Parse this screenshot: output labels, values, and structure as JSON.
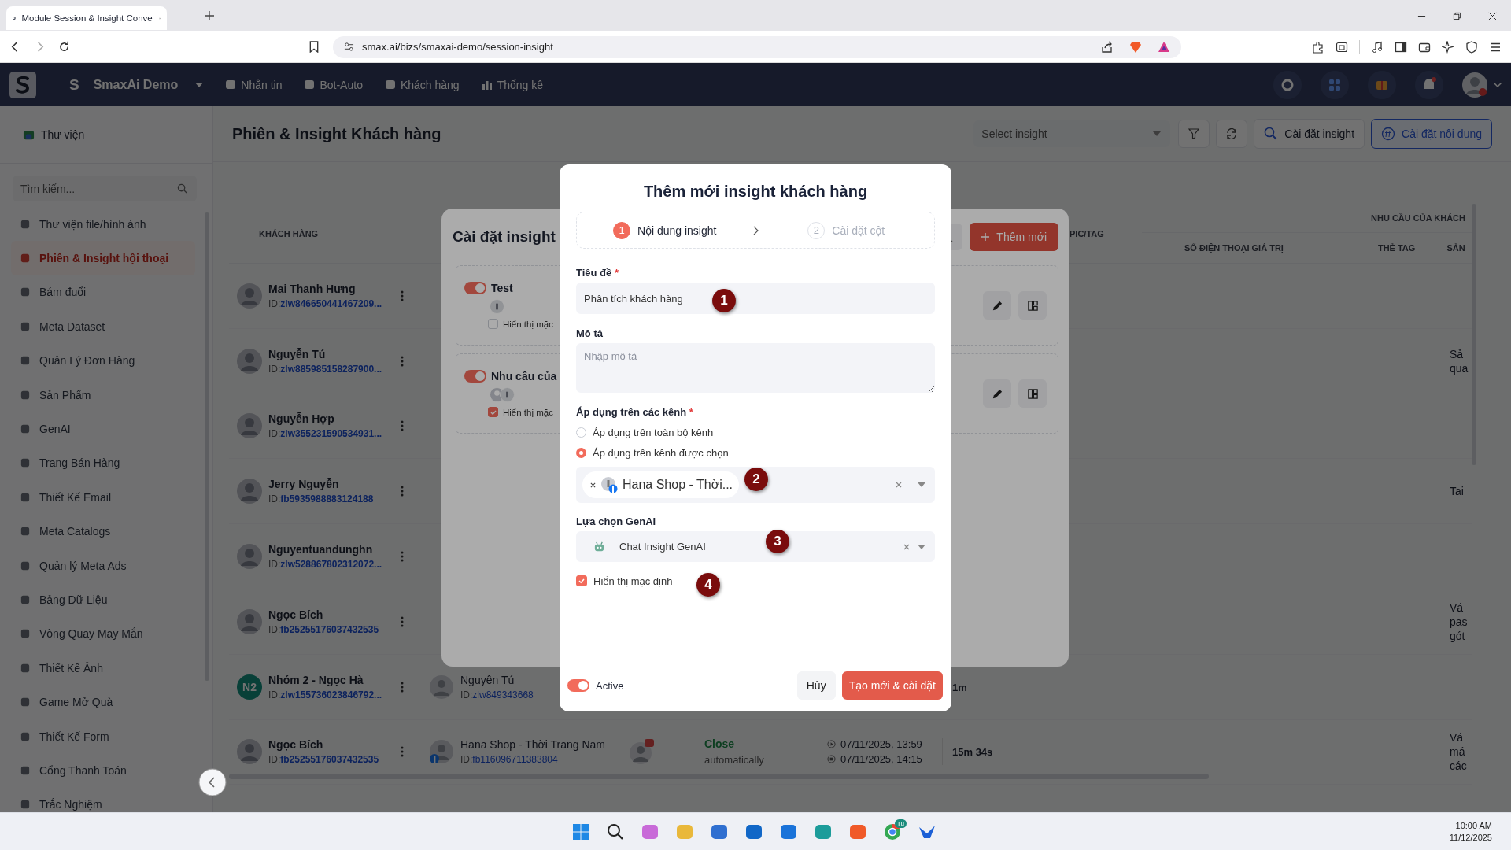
{
  "browser": {
    "tab_title": "Module Session & Insight Conve",
    "url": "smax.ai/bizs/smaxai-demo/session-insight"
  },
  "navbar": {
    "workspace_letter": "S",
    "workspace": "SmaxAi Demo",
    "items": [
      {
        "label": "Nhắn tin"
      },
      {
        "label": "Bot-Auto"
      },
      {
        "label": "Khách hàng"
      },
      {
        "label": "Thống kê"
      }
    ]
  },
  "sidebar": {
    "header": "Thư viện",
    "search_placeholder": "Tìm kiếm...",
    "items": [
      {
        "label": "Thư viện file/hình ảnh",
        "selected": false
      },
      {
        "label": "Phiên & Insight hội thoại",
        "selected": true
      },
      {
        "label": "Bám đuổi",
        "selected": false
      },
      {
        "label": "Meta Dataset",
        "selected": false
      },
      {
        "label": "Quản Lý Đơn Hàng",
        "selected": false
      },
      {
        "label": "Sản Phẩm",
        "selected": false
      },
      {
        "label": "GenAI",
        "selected": false
      },
      {
        "label": "Trang Bán Hàng",
        "selected": false
      },
      {
        "label": "Thiết Kế Email",
        "selected": false
      },
      {
        "label": "Meta Catalogs",
        "selected": false
      },
      {
        "label": "Quản lý Meta Ads",
        "selected": false
      },
      {
        "label": "Bảng Dữ Liệu",
        "selected": false
      },
      {
        "label": "Vòng Quay May Mắn",
        "selected": false
      },
      {
        "label": "Thiết Kế Ảnh",
        "selected": false
      },
      {
        "label": "Game Mở Quà",
        "selected": false
      },
      {
        "label": "Thiết Kế Form",
        "selected": false
      },
      {
        "label": "Cổng Thanh Toán",
        "selected": false
      },
      {
        "label": "Trắc Nghiệm",
        "selected": false
      }
    ]
  },
  "page": {
    "title": "Phiên & Insight Khách hàng",
    "insight_select": {
      "placeholder": "Select insight"
    },
    "buttons": [
      {
        "label": "Cài đặt insight",
        "kind": "plain"
      },
      {
        "label": "Cài đặt nội dung",
        "kind": "outline"
      }
    ]
  },
  "table": {
    "columns": [
      {
        "label": "KHÁCH HÀNG"
      },
      {
        "label": "PIC/TAG"
      }
    ],
    "group": {
      "label": "NHU CẦU CỦA KHÁCH",
      "columns": [
        {
          "label": "SỐ ĐIỆN THOẠI GIÁ TRỊ"
        },
        {
          "label": "THẺ TAG"
        },
        {
          "label": "SẢN"
        }
      ]
    },
    "rows": [
      {
        "customer": {
          "name": "Mai Thanh Hưng",
          "id_label": "ID:",
          "id": "zlw846650441467209..."
        }
      },
      {
        "customer": {
          "name": "Nguyễn Tú",
          "id_label": "ID:",
          "id": "zlw885985158287900..."
        },
        "needs": [
          "Sả",
          "qua"
        ]
      },
      {
        "customer": {
          "name": "Nguyễn Hợp",
          "id_label": "ID:",
          "id": "zlw355231590534931..."
        }
      },
      {
        "customer": {
          "name": "Jerry Nguyễn",
          "id_label": "ID:",
          "id": "fb5935988883124188"
        },
        "needs": [
          "Tai"
        ]
      },
      {
        "customer": {
          "name": "Nguyentuandunghn",
          "id_label": "ID:",
          "id": "zlw528867802312072..."
        }
      },
      {
        "customer": {
          "name": "Ngọc Bích",
          "id_label": "ID:",
          "id": "fb25255176037432535"
        },
        "needs": [
          "Vá",
          "pas",
          "gót"
        ]
      },
      {
        "customer": {
          "name": "Nhóm 2 - Ngọc Hà",
          "id_label": "ID:",
          "id": "zlw155736023846792...",
          "avatar": "N2"
        },
        "channel": {
          "name": "Nguyễn Tú",
          "id_label": "ID:",
          "id": "zlw849343668",
          "facebook": false
        },
        "duration": "1m"
      },
      {
        "customer": {
          "name": "Ngọc Bích",
          "id_label": "ID:",
          "id": "fb25255176037432535"
        },
        "channel": {
          "name": "Hana Shop - Thời Trang Nam",
          "id_label": "ID:",
          "id": "fb116096711383804",
          "facebook": true
        },
        "pic": {
          "kind": "avatar"
        },
        "status": {
          "label": "Close",
          "note": "automatically"
        },
        "times": [
          {
            "kind": "start",
            "text": "07/11/2025, 13:59"
          },
          {
            "kind": "end",
            "text": "07/11/2025, 14:15"
          }
        ],
        "duration": "15m 34s",
        "needs": [
          "Vá",
          "má",
          "các"
        ]
      }
    ]
  },
  "insight_settings": {
    "title": "Cài đặt insight",
    "add_button": "Thêm mới",
    "items": [
      {
        "name": "Test",
        "active": true,
        "channels": [
          {
            "kind": "page"
          }
        ],
        "show_default": false,
        "show_default_label": "Hiển thị mặc"
      },
      {
        "name": "Nhu cầu của",
        "active": true,
        "channels": [
          {
            "kind": "person"
          },
          {
            "kind": "page"
          }
        ],
        "show_default": true,
        "show_default_label": "Hiển thị mặc"
      }
    ]
  },
  "new_insight": {
    "title": "Thêm mới insight khách hàng",
    "steps": [
      {
        "number": "1",
        "label": "Nội dung insight",
        "selected": true
      },
      {
        "number": "2",
        "label": "Cài đặt cột",
        "selected": false
      }
    ],
    "title_field": {
      "label": "Tiêu đề",
      "required_mark": "*",
      "value": "Phân tích khách hàng"
    },
    "description_field": {
      "label": "Mô tả",
      "placeholder": "Nhập mô tả"
    },
    "channels_field": {
      "label": "Áp dụng trên các kênh",
      "required_mark": "*",
      "options": [
        {
          "label": "Áp dụng trên toàn bộ kênh",
          "selected": false
        },
        {
          "label": "Áp dụng trên kênh được chọn",
          "selected": true
        }
      ],
      "chips": [
        {
          "label": "Hana Shop - Thời..."
        }
      ]
    },
    "genai_field": {
      "label": "Lựa chọn GenAI",
      "value": "Chat Insight GenAI"
    },
    "show_default": {
      "label": "Hiển thị mặc định",
      "checked": true
    },
    "active": {
      "label": "Active",
      "on": true
    },
    "cancel": "Hủy",
    "submit": "Tạo mới & cài đặt"
  },
  "annotations": [
    {
      "number": "1"
    },
    {
      "number": "2"
    },
    {
      "number": "3"
    },
    {
      "number": "4"
    }
  ],
  "taskbar": {
    "chrome_badge": "Tú",
    "time": "10:00 AM",
    "date": "11/12/2025"
  }
}
